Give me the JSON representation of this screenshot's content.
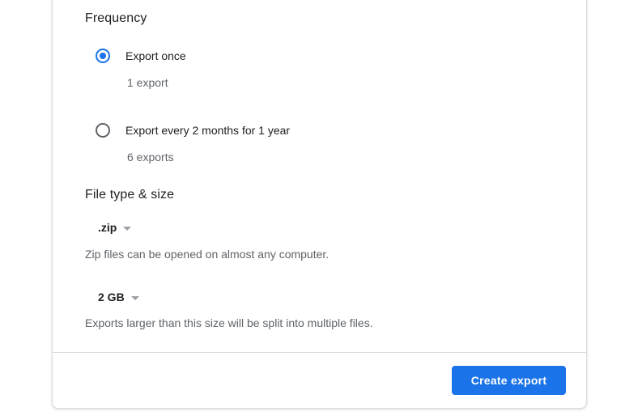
{
  "frequency": {
    "title": "Frequency",
    "options": [
      {
        "label": "Export once",
        "sub": "1 export",
        "selected": true
      },
      {
        "label": "Export every 2 months for 1 year",
        "sub": "6 exports",
        "selected": false
      }
    ]
  },
  "file": {
    "title": "File type & size",
    "type": {
      "value": ".zip",
      "helper": "Zip files can be opened on almost any computer."
    },
    "size": {
      "value": "2 GB",
      "helper": "Exports larger than this size will be split into multiple files."
    }
  },
  "footer": {
    "create_label": "Create export"
  },
  "colors": {
    "accent": "#1a73e8",
    "text_primary": "#202124",
    "text_secondary": "#5f6368",
    "divider": "#dadce0"
  },
  "icons": {
    "radio_selected": "radio-checked-icon",
    "radio_unselected": "radio-unchecked-icon",
    "dropdown_caret": "caret-down-icon"
  }
}
